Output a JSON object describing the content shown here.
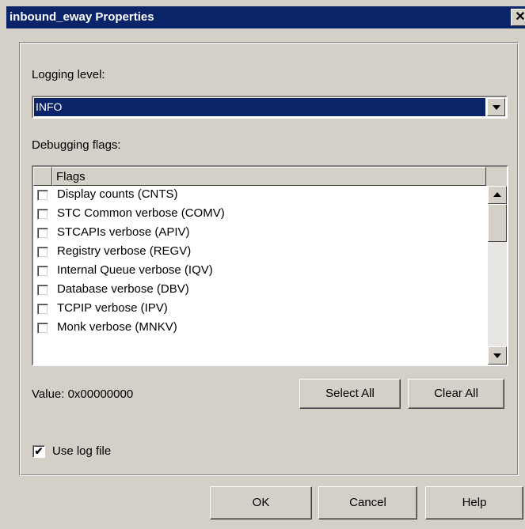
{
  "window": {
    "title": "inbound_eway Properties",
    "close_glyph": "✕"
  },
  "logging": {
    "label": "Logging level:",
    "selected": "INFO"
  },
  "debug": {
    "label": "Debugging flags:",
    "column_header": "Flags",
    "flags": [
      {
        "label": "Display counts (CNTS)",
        "checked": false
      },
      {
        "label": "STC Common verbose (COMV)",
        "checked": false
      },
      {
        "label": "STCAPIs verbose (APIV)",
        "checked": false
      },
      {
        "label": "Registry verbose (REGV)",
        "checked": false
      },
      {
        "label": "Internal Queue verbose (IQV)",
        "checked": false
      },
      {
        "label": "Database verbose (DBV)",
        "checked": false
      },
      {
        "label": "TCPIP verbose (IPV)",
        "checked": false
      },
      {
        "label": "Monk verbose (MNKV)",
        "checked": false
      }
    ]
  },
  "value_text": "Value: 0x00000000",
  "buttons": {
    "select_all": "Select All",
    "clear_all": "Clear All",
    "ok": "OK",
    "cancel": "Cancel",
    "help": "Help"
  },
  "use_log_file": {
    "label": "Use log file",
    "checked": true,
    "check_glyph": "✔"
  },
  "colors": {
    "titlebar": "#0a246a",
    "face": "#d4d0c8",
    "selection": "#0a246a"
  }
}
